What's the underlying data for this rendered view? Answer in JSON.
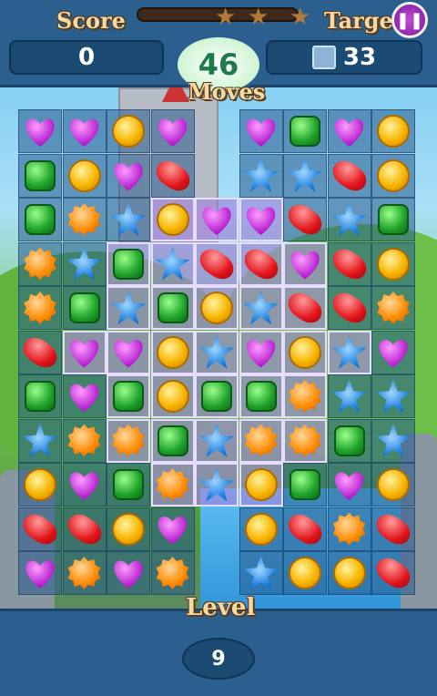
{
  "header": {
    "score_label": "Score",
    "score_value": "0",
    "target_label": "Target",
    "target_value": "33",
    "moves_value": "46",
    "moves_label": "Moves"
  },
  "footer": {
    "level_label": "Level",
    "level_value": "9"
  },
  "colors": {
    "header_bg": "#2b5f8e",
    "label_gold": "#f5d9a3",
    "pause_purple": "#9b2bb8"
  },
  "board": {
    "rows": [
      [
        "heart",
        "heart",
        "coin",
        "heart",
        null,
        "heart",
        "square",
        "heart",
        "coin"
      ],
      [
        "square",
        "coin",
        "heart",
        "bean",
        null,
        "star",
        "star",
        "bean",
        "coin"
      ],
      [
        "square",
        "flower",
        "star",
        "coin",
        "heart",
        "heart",
        "bean",
        "star",
        "square"
      ],
      [
        "flower",
        "star",
        "square",
        "star",
        "bean",
        "bean",
        "heart",
        "bean",
        "coin"
      ],
      [
        "flower",
        "square",
        "star",
        "square",
        "coin",
        "star",
        "bean",
        "bean",
        "flower"
      ],
      [
        "bean",
        "heart",
        "heart",
        "coin",
        "star",
        "heart",
        "coin",
        "star",
        "heart"
      ],
      [
        "square",
        "heart",
        "square",
        "coin",
        "square",
        "square",
        "flower",
        "star",
        "star"
      ],
      [
        "star",
        "flower",
        "flower",
        "square",
        "star",
        "flower",
        "flower",
        "square",
        "star"
      ],
      [
        "coin",
        "heart",
        "square",
        "flower",
        "star",
        "coin",
        "square",
        "heart",
        "coin"
      ],
      [
        "bean",
        "bean",
        "coin",
        "heart",
        null,
        "coin",
        "bean",
        "flower",
        "bean"
      ],
      [
        "heart",
        "flower",
        "heart",
        "flower",
        null,
        "star",
        "coin",
        "coin",
        "bean"
      ]
    ],
    "highlighted": [
      [
        2,
        3
      ],
      [
        2,
        4
      ],
      [
        2,
        5
      ],
      [
        3,
        2
      ],
      [
        3,
        3
      ],
      [
        3,
        4
      ],
      [
        3,
        5
      ],
      [
        3,
        6
      ],
      [
        4,
        2
      ],
      [
        4,
        3
      ],
      [
        4,
        4
      ],
      [
        4,
        5
      ],
      [
        4,
        6
      ],
      [
        5,
        1
      ],
      [
        5,
        2
      ],
      [
        5,
        3
      ],
      [
        5,
        4
      ],
      [
        5,
        5
      ],
      [
        5,
        6
      ],
      [
        5,
        7
      ],
      [
        6,
        2
      ],
      [
        6,
        3
      ],
      [
        6,
        4
      ],
      [
        6,
        5
      ],
      [
        6,
        6
      ],
      [
        7,
        2
      ],
      [
        7,
        3
      ],
      [
        7,
        4
      ],
      [
        7,
        5
      ],
      [
        7,
        6
      ],
      [
        8,
        3
      ],
      [
        8,
        4
      ],
      [
        8,
        5
      ]
    ]
  }
}
